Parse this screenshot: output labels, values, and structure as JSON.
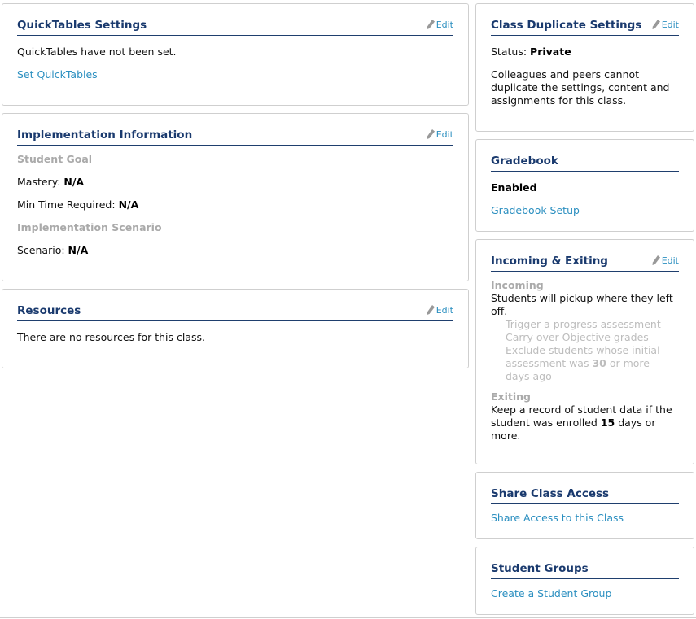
{
  "edit_label": "Edit",
  "quicktables": {
    "title": "QuickTables Settings",
    "status_text": "QuickTables have not been set.",
    "link": "Set QuickTables"
  },
  "implementation": {
    "title": "Implementation Information",
    "goal_heading": "Student Goal",
    "mastery_label": "Mastery:",
    "mastery_value": "N/A",
    "min_time_label": "Min Time Required:",
    "min_time_value": "N/A",
    "scenario_heading": "Implementation Scenario",
    "scenario_label": "Scenario:",
    "scenario_value": "N/A"
  },
  "resources": {
    "title": "Resources",
    "text": "There are no resources for this class."
  },
  "duplicate": {
    "title": "Class Duplicate Settings",
    "status_label": "Status:",
    "status_value": "Private",
    "description": "Colleagues and peers cannot duplicate the settings, content and assignments for this class."
  },
  "gradebook": {
    "title": "Gradebook",
    "status": "Enabled",
    "link": "Gradebook Setup"
  },
  "incoming_exiting": {
    "title": "Incoming & Exiting",
    "incoming_heading": "Incoming",
    "incoming_text": "Students will pickup where they left off.",
    "option_trigger": "Trigger a progress assessment",
    "option_carry": "Carry over Objective grades",
    "option_exclude_pre": "Exclude students whose initial assessment was",
    "option_exclude_days": "30",
    "option_exclude_post": "or more days ago",
    "exiting_heading": "Exiting",
    "exiting_pre": "Keep a record of student data if the student was enrolled",
    "exiting_days": "15",
    "exiting_post": "days or more."
  },
  "share": {
    "title": "Share Class Access",
    "link": "Share Access to this Class"
  },
  "groups": {
    "title": "Student Groups",
    "link": "Create a Student Group"
  },
  "colors": {
    "title": "#1a3a6e",
    "link": "#2b8fc0",
    "muted": "#aaaaaa",
    "border": "#cfcfcf"
  }
}
